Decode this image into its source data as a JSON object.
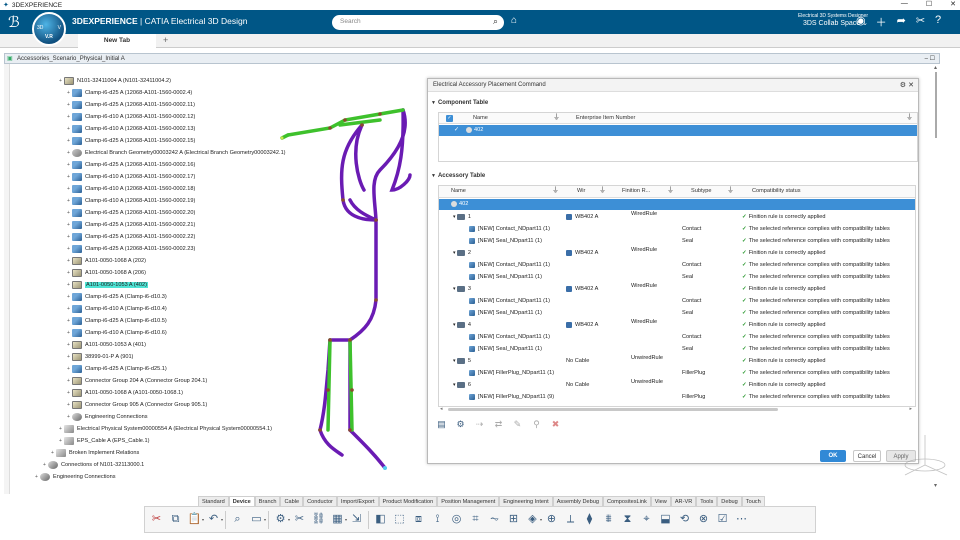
{
  "window": {
    "title": "3DEXPERIENCE",
    "controls": [
      "—",
      "☐",
      "✕"
    ]
  },
  "header": {
    "brand_bold": "3DEXPERIENCE",
    "brand_rest": " | CATIA  Electrical 3D Design",
    "compass_version": "V.R",
    "compass_d": "3D",
    "compass_v": "V",
    "search_placeholder": "Search",
    "user_role": "Electrical 3D Systems Designer",
    "collab_space": "3DS Collab Space",
    "collab_chevron": "⌄"
  },
  "tabs": {
    "active": "New Tab",
    "add": "+"
  },
  "document": {
    "title": "Accessories_Scenario_Physical_Initial A"
  },
  "tree": [
    {
      "label": "N101-32411004 A (N101-32411004.2)",
      "icon": "prod",
      "depth": 3,
      "row": 0
    },
    {
      "label": "Clamp-i6-d25 A (12068-A101-1560-0002.4)",
      "icon": "clamp",
      "depth": 4,
      "row": 1
    },
    {
      "label": "Clamp-i6-d25 A (12068-A101-1560-0002.11)",
      "icon": "clamp",
      "depth": 4,
      "row": 2
    },
    {
      "label": "Clamp-i6-d10 A (12068-A101-1560-0002.12)",
      "icon": "clamp",
      "depth": 4,
      "row": 3
    },
    {
      "label": "Clamp-i6-d10 A (12068-A101-1560-0002.13)",
      "icon": "clamp",
      "depth": 4,
      "row": 4
    },
    {
      "label": "Clamp-i6-d25 A (12068-A101-1560-0002.15)",
      "icon": "clamp",
      "depth": 4,
      "row": 5
    },
    {
      "label": "Electrical Branch Geometry00003242 A (Electrical Branch Geometry00003242.1)",
      "icon": "geo",
      "depth": 4,
      "row": 6
    },
    {
      "label": "Clamp-i6-d25 A (12068-A101-1560-0002.16)",
      "icon": "clamp",
      "depth": 4,
      "row": 7
    },
    {
      "label": "Clamp-i6-d10 A (12068-A101-1560-0002.17)",
      "icon": "clamp",
      "depth": 4,
      "row": 8
    },
    {
      "label": "Clamp-i6-d10 A (12068-A101-1560-0002.18)",
      "icon": "clamp",
      "depth": 4,
      "row": 9
    },
    {
      "label": "Clamp-i6-d10 A (12068-A101-1560-0002.19)",
      "icon": "clamp",
      "depth": 4,
      "row": 10
    },
    {
      "label": "Clamp-i6-d25 A (12068-A101-1560-0002.20)",
      "icon": "clamp",
      "depth": 4,
      "row": 11
    },
    {
      "label": "Clamp-i6-d25 A (12068-A101-1560-0002.21)",
      "icon": "clamp",
      "depth": 4,
      "row": 12
    },
    {
      "label": "Clamp-i6-d25 A (12068-A101-1560-0002.22)",
      "icon": "clamp",
      "depth": 4,
      "row": 13
    },
    {
      "label": "Clamp-i6-d25 A (12068-A101-1560-0002.23)",
      "icon": "clamp",
      "depth": 4,
      "row": 14
    },
    {
      "label": "A101-0050-1068 A (202)",
      "icon": "prod",
      "depth": 4,
      "row": 15
    },
    {
      "label": "A101-0050-1068 A (206)",
      "icon": "prod",
      "depth": 4,
      "row": 16
    },
    {
      "label": "A101-0050-1053 A (402)",
      "icon": "prod",
      "depth": 4,
      "row": 17,
      "highlight": true
    },
    {
      "label": "Clamp-i6-d25 A (Clamp-i6-d10.3)",
      "icon": "clamp",
      "depth": 4,
      "row": 18
    },
    {
      "label": "Clamp-i6-d10 A (Clamp-i6-d10.4)",
      "icon": "clamp",
      "depth": 4,
      "row": 19
    },
    {
      "label": "Clamp-i6-d25 A (Clamp-i6-d10.5)",
      "icon": "clamp",
      "depth": 4,
      "row": 20
    },
    {
      "label": "Clamp-i6-d10 A (Clamp-i6-d10.6)",
      "icon": "clamp",
      "depth": 4,
      "row": 21
    },
    {
      "label": "A101-0050-1053 A (401)",
      "icon": "prod",
      "depth": 4,
      "row": 22
    },
    {
      "label": "38999-01-P A (901)",
      "icon": "prod",
      "depth": 4,
      "row": 23
    },
    {
      "label": "Clamp-i6-d25 A (Clamp-i6-d25.1)",
      "icon": "clamp",
      "depth": 4,
      "row": 24
    },
    {
      "label": "Connector Group 204 A (Connector Group 204.1)",
      "icon": "prod",
      "depth": 4,
      "row": 25
    },
    {
      "label": "A101-0050-1068 A (A101-0050-1068.1)",
      "icon": "prod",
      "depth": 4,
      "row": 26
    },
    {
      "label": "Connector Group 905 A (Connector Group 905.1)",
      "icon": "prod",
      "depth": 4,
      "row": 27
    },
    {
      "label": "Engineering Connections",
      "icon": "eng",
      "depth": 4,
      "row": 28
    },
    {
      "label": "Electrical Physical System00000554 A (Electrical Physical System00000554.1)",
      "icon": "sys",
      "depth": 3,
      "row": 29
    },
    {
      "label": "EPS_Cable A (EPS_Cable.1)",
      "icon": "sys",
      "depth": 3,
      "row": 30
    },
    {
      "label": "Broken Implement Relations",
      "icon": "sys",
      "depth": 2,
      "row": 31
    },
    {
      "label": "Connections of N101-32113000.1",
      "icon": "eng",
      "depth": 1,
      "row": 32
    },
    {
      "label": "Engineering Connections",
      "icon": "eng",
      "depth": 0,
      "row": 33
    }
  ],
  "panel": {
    "title": "Electrical Accessory Placement Command",
    "gear": "⚙",
    "close": "✕",
    "component_section": "Component Table",
    "component_cols": {
      "name": "Name",
      "enterprise": "Enterprise Item Number"
    },
    "component_selected": "402",
    "accessory_section": "Accessory Table",
    "accessory_cols": {
      "name": "Name",
      "wire": "Wir",
      "rule": "Finition R...",
      "subtype": "Subtype",
      "compat": "Compatibility status"
    },
    "accessory_root": "402",
    "accessory_rows": [
      {
        "indent": 1,
        "name": "1",
        "kind": "group",
        "wire": "WB402 A",
        "rule": "WiredRule",
        "subtype": "",
        "status": "Finition rule is correctly applied"
      },
      {
        "indent": 2,
        "name": "[NEW] Contact_NDpart11 (1)",
        "kind": "item",
        "wire": "",
        "rule": "",
        "subtype": "Contact",
        "status": "The selected reference complies with compatibility tables"
      },
      {
        "indent": 2,
        "name": "[NEW] Seal_NDpart11 (1)",
        "kind": "item",
        "wire": "",
        "rule": "",
        "subtype": "Seal",
        "status": "The selected reference complies with compatibility tables"
      },
      {
        "indent": 1,
        "name": "2",
        "kind": "group",
        "wire": "WB402 A",
        "rule": "WiredRule",
        "subtype": "",
        "status": "Finition rule is correctly applied"
      },
      {
        "indent": 2,
        "name": "[NEW] Contact_NDpart11 (1)",
        "kind": "item",
        "wire": "",
        "rule": "",
        "subtype": "Contact",
        "status": "The selected reference complies with compatibility tables"
      },
      {
        "indent": 2,
        "name": "[NEW] Seal_NDpart11 (1)",
        "kind": "item",
        "wire": "",
        "rule": "",
        "subtype": "Seal",
        "status": "The selected reference complies with compatibility tables"
      },
      {
        "indent": 1,
        "name": "3",
        "kind": "group",
        "wire": "WB402 A",
        "rule": "WiredRule",
        "subtype": "",
        "status": "Finition rule is correctly applied"
      },
      {
        "indent": 2,
        "name": "[NEW] Contact_NDpart11 (1)",
        "kind": "item",
        "wire": "",
        "rule": "",
        "subtype": "Contact",
        "status": "The selected reference complies with compatibility tables"
      },
      {
        "indent": 2,
        "name": "[NEW] Seal_NDpart11 (1)",
        "kind": "item",
        "wire": "",
        "rule": "",
        "subtype": "Seal",
        "status": "The selected reference complies with compatibility tables"
      },
      {
        "indent": 1,
        "name": "4",
        "kind": "group",
        "wire": "WB402 A",
        "rule": "WiredRule",
        "subtype": "",
        "status": "Finition rule is correctly applied"
      },
      {
        "indent": 2,
        "name": "[NEW] Contact_NDpart11 (1)",
        "kind": "item",
        "wire": "",
        "rule": "",
        "subtype": "Contact",
        "status": "The selected reference complies with compatibility tables"
      },
      {
        "indent": 2,
        "name": "[NEW] Seal_NDpart11 (1)",
        "kind": "item",
        "wire": "",
        "rule": "",
        "subtype": "Seal",
        "status": "The selected reference complies with compatibility tables"
      },
      {
        "indent": 1,
        "name": "5",
        "kind": "group",
        "wire": "No Cable",
        "rule": "UnwiredRule",
        "subtype": "",
        "status": "Finition rule is correctly applied"
      },
      {
        "indent": 2,
        "name": "[NEW] FillerPlug_NDpart11 (1)",
        "kind": "item",
        "wire": "",
        "rule": "",
        "subtype": "FillerPlug",
        "status": "The selected reference complies with compatibility tables"
      },
      {
        "indent": 1,
        "name": "6",
        "kind": "group",
        "wire": "No Cable",
        "rule": "UnwiredRule",
        "subtype": "",
        "status": "Finition rule is correctly applied"
      },
      {
        "indent": 2,
        "name": "[NEW] FillerPlug_NDpart11 (9)",
        "kind": "item",
        "wire": "",
        "rule": "",
        "subtype": "FillerPlug",
        "status": "The selected reference complies with compatibility tables"
      }
    ],
    "buttons": {
      "ok": "OK",
      "cancel": "Cancel",
      "apply": "Apply"
    }
  },
  "workbench_tabs": [
    "Standard",
    "Device",
    "Branch",
    "Cable",
    "Conductor",
    "Import/Export",
    "Product Modification",
    "Position Management",
    "Engineering Intent",
    "Assembly Debug",
    "CompositesLink",
    "View",
    "AR-VR",
    "Tools",
    "Debug",
    "Touch"
  ],
  "workbench_active": "Device",
  "colors": {
    "topbar": "#005686",
    "accent": "#3189d6",
    "highlight": "#4ee3d4",
    "harness_purple": "#6a1bb3",
    "harness_green": "#3ec12c"
  }
}
